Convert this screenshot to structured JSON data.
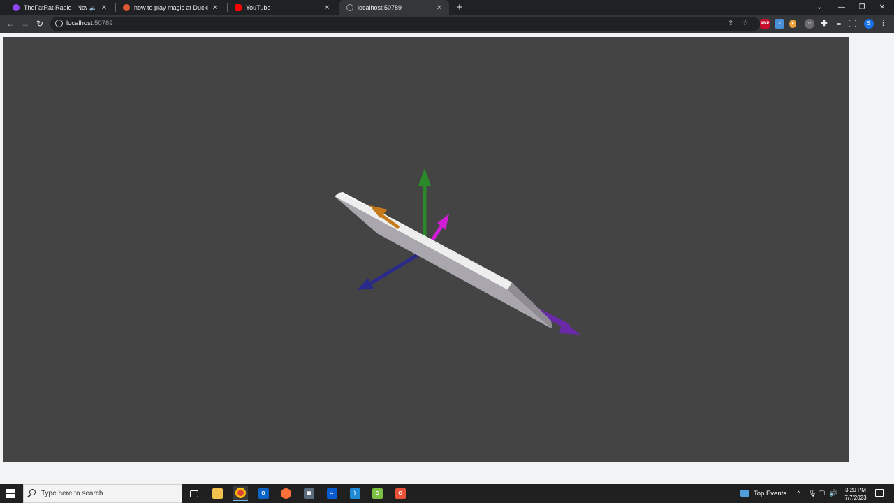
{
  "browser": {
    "tabs": [
      {
        "title": "TheFatRat Radio - Now Playi",
        "has_audio": true,
        "favicon": "twitch-icon",
        "favicon_color": "#9146ff"
      },
      {
        "title": "how to play magic at DuckDuckG",
        "has_audio": false,
        "favicon": "duckduckgo-icon",
        "favicon_color": "#de5833"
      },
      {
        "title": "YouTube",
        "has_audio": false,
        "favicon": "youtube-icon",
        "favicon_color": "#ff0000"
      },
      {
        "title": "localhost:50789",
        "has_audio": false,
        "favicon": "globe-icon",
        "favicon_color": "#9aa0a6",
        "active": true
      }
    ],
    "tab_close_glyph": "✕",
    "new_tab_glyph": "+",
    "window_controls": {
      "tab_search": "⌄",
      "minimize": "—",
      "restore": "❐",
      "close": "✕"
    },
    "address": {
      "host": "localhost",
      "port": ":50789"
    },
    "nav": {
      "back": "←",
      "forward": "→",
      "reload": "↻"
    },
    "extensions": [
      {
        "name": "adblock-plus-icon",
        "label": "ABP",
        "color": "#c70d2c"
      },
      {
        "name": "extension-doc-icon",
        "label": "≡",
        "color": "#4a90d9"
      },
      {
        "name": "extension-pin-icon",
        "label": "●",
        "color": "#e8a33d"
      },
      {
        "name": "extension-face-icon",
        "label": "☺",
        "color": "#6d6d6d"
      }
    ],
    "profile_initial": "S"
  },
  "scene": {
    "background": "#444444",
    "board_color": "#d5d3d8",
    "axes": [
      {
        "name": "y-axis-arrow",
        "color": "#2a8a2a"
      },
      {
        "name": "x-axis-arrow",
        "color": "#2a2a8a"
      },
      {
        "name": "magenta-arrow",
        "color": "#d21dd6"
      },
      {
        "name": "orange-arrow",
        "color": "#c57a19"
      },
      {
        "name": "purple-arrow",
        "color": "#6a2aa8"
      }
    ]
  },
  "taskbar": {
    "search_placeholder": "Type here to search",
    "widget_label": "Top Events",
    "time": "3:20 PM",
    "date": "7/7/2023",
    "tray_chevron": "^"
  }
}
